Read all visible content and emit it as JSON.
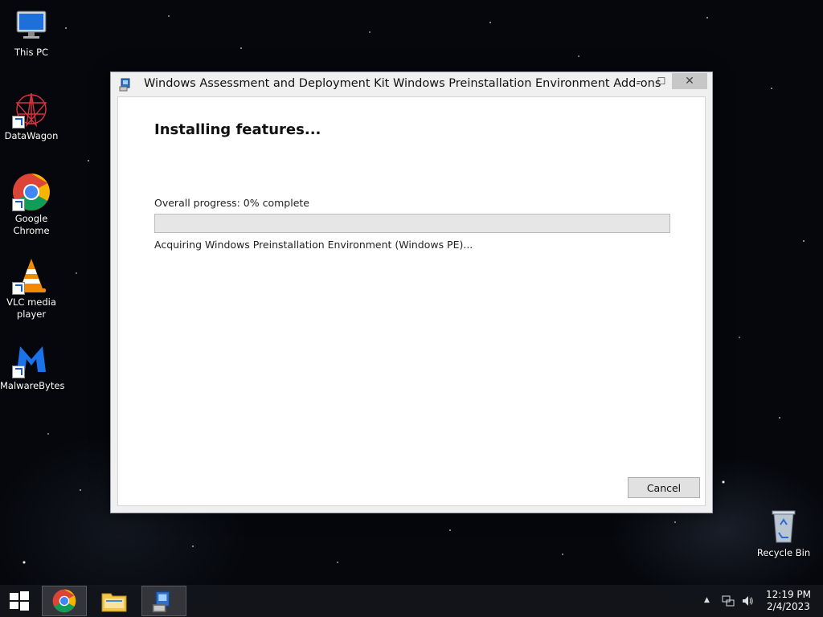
{
  "desktop": {
    "icons": [
      {
        "label": "This PC"
      },
      {
        "label": "DataWagon"
      },
      {
        "label": "Google\nChrome"
      },
      {
        "label": "VLC media\nplayer"
      },
      {
        "label": "MalwareBytes"
      },
      {
        "label": "Recycle Bin"
      }
    ]
  },
  "window": {
    "title": "Windows Assessment and Deployment Kit Windows Preinstallation Environment Add-ons",
    "controls": {
      "minimize": "–",
      "maximize": "☐",
      "close": "✕"
    },
    "heading": "Installing features...",
    "progress": {
      "label": "Overall progress: 0% complete",
      "value": 0
    },
    "status": "Acquiring Windows Preinstallation Environment (Windows PE)...",
    "cancel_label": "Cancel"
  },
  "taskbar": {
    "items": [
      "start-button",
      "chrome-icon",
      "file-explorer-icon",
      "installer-icon"
    ],
    "clock": {
      "time": "12:19 PM",
      "date": "2/4/2023"
    },
    "colors": {
      "progress_fill": "#06b025",
      "close_hover": "#c7c7c7"
    }
  }
}
